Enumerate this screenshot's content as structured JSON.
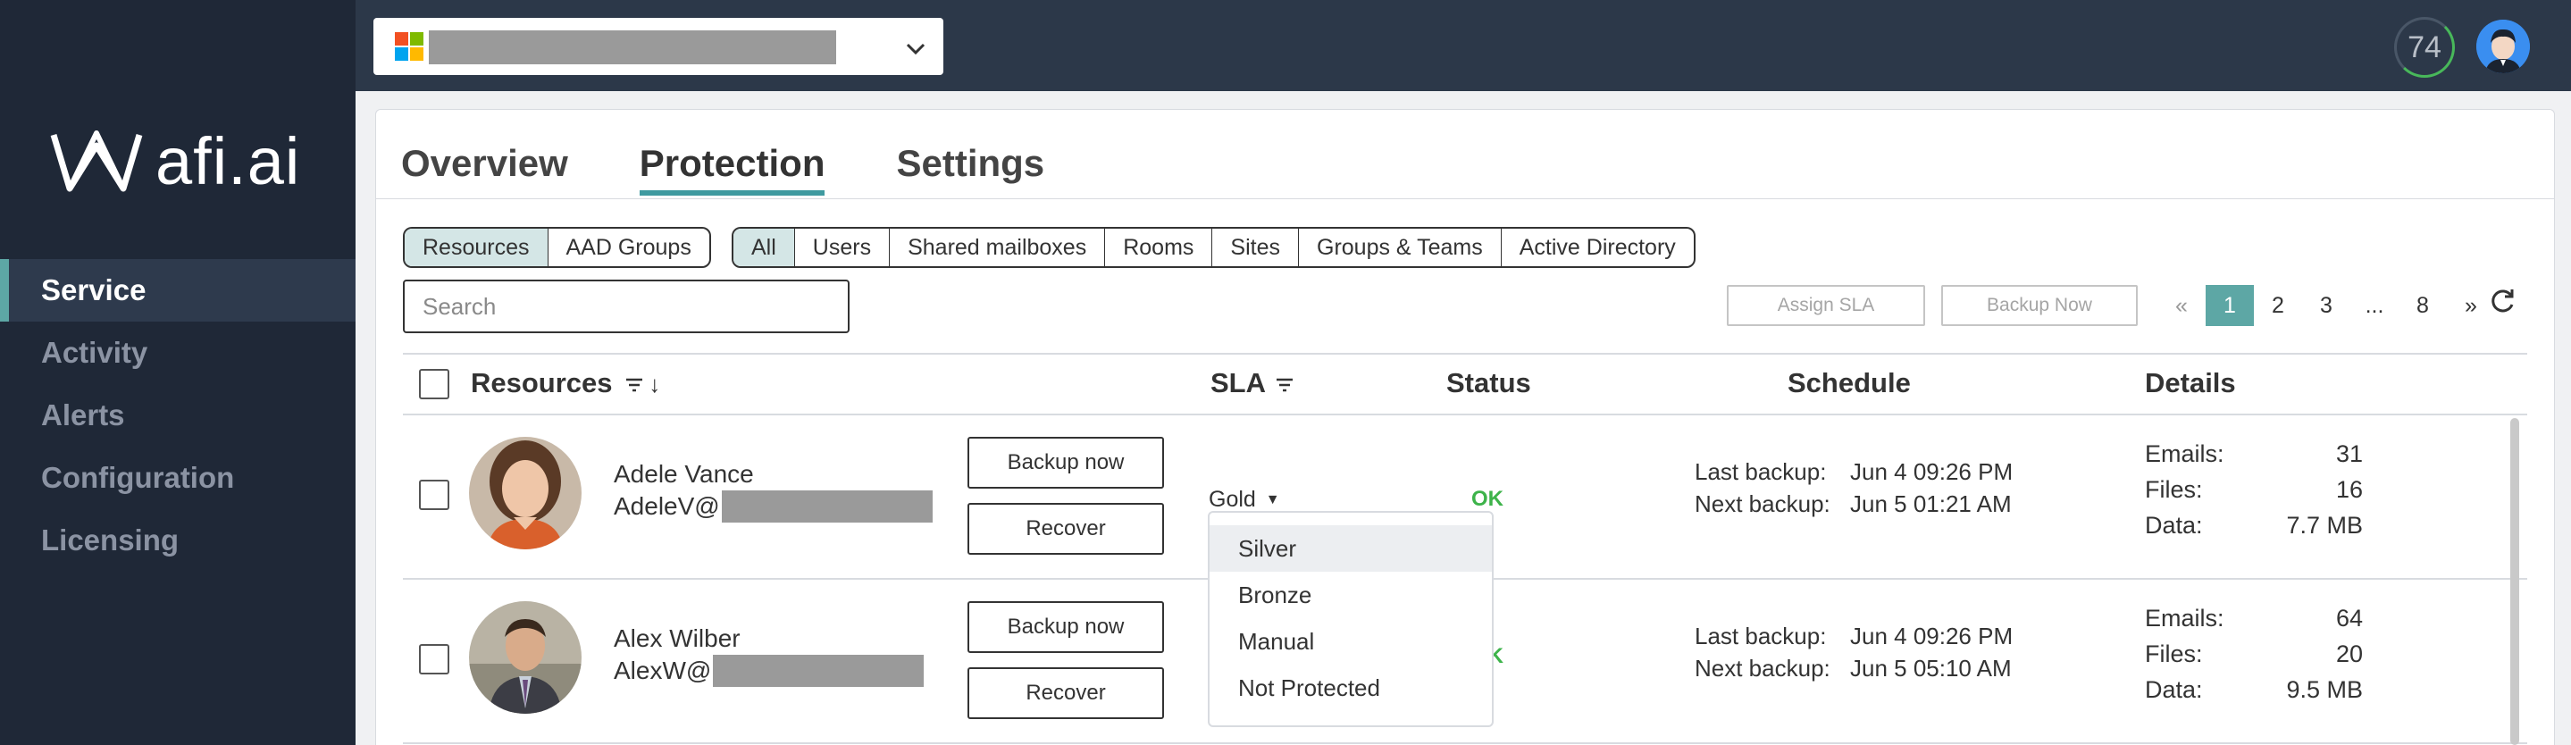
{
  "brand": {
    "logo_text": "afi.ai"
  },
  "sidebar": {
    "items": [
      {
        "label": "Service"
      },
      {
        "label": "Activity"
      },
      {
        "label": "Alerts"
      },
      {
        "label": "Configuration"
      },
      {
        "label": "Licensing"
      }
    ]
  },
  "topbar": {
    "score": "74"
  },
  "tabs": [
    {
      "label": "Overview"
    },
    {
      "label": "Protection"
    },
    {
      "label": "Settings"
    }
  ],
  "scope_filter": [
    {
      "label": "Resources"
    },
    {
      "label": "AAD Groups"
    }
  ],
  "type_filter": [
    {
      "label": "All"
    },
    {
      "label": "Users"
    },
    {
      "label": "Shared mailboxes"
    },
    {
      "label": "Rooms"
    },
    {
      "label": "Sites"
    },
    {
      "label": "Groups & Teams"
    },
    {
      "label": "Active Directory"
    }
  ],
  "search": {
    "placeholder": "Search"
  },
  "actions": {
    "assign_sla": "Assign SLA",
    "backup_now": "Backup Now"
  },
  "pager": {
    "prev": "«",
    "pages": [
      "1",
      "2",
      "3",
      "...",
      "8"
    ],
    "next": "»"
  },
  "table": {
    "headers": {
      "resources": "Resources",
      "sla": "SLA",
      "status": "Status",
      "schedule": "Schedule",
      "details": "Details"
    },
    "rows": [
      {
        "name": "Adele Vance",
        "email_prefix": "AdeleV@",
        "sla": "Gold",
        "status": "OK",
        "backup_btn": "Backup now",
        "recover_btn": "Recover",
        "last_backup_label": "Last backup:",
        "last_backup": "Jun 4 09:26 PM",
        "next_backup_label": "Next backup:",
        "next_backup": "Jun 5 01:21 AM",
        "emails_label": "Emails:",
        "emails": "31",
        "files_label": "Files:",
        "files": "16",
        "data_label": "Data:",
        "data": "7.7 MB"
      },
      {
        "name": "Alex Wilber",
        "email_prefix": "AlexW@",
        "sla": "",
        "status": "OK",
        "backup_btn": "Backup now",
        "recover_btn": "Recover",
        "last_backup_label": "Last backup:",
        "last_backup": "Jun 4 09:26 PM",
        "next_backup_label": "Next backup:",
        "next_backup": "Jun 5 05:10 AM",
        "emails_label": "Emails:",
        "emails": "64",
        "files_label": "Files:",
        "files": "20",
        "data_label": "Data:",
        "data": "9.5 MB"
      }
    ]
  },
  "sla_dropdown": {
    "options": [
      "Silver",
      "Bronze",
      "Manual",
      "Not Protected"
    ]
  },
  "colors": {
    "accent": "#5da7a5",
    "sidebar_bg": "#1f2837",
    "topbar_bg": "#2c3849",
    "ok_green": "#3db34a",
    "redaction_gray": "#9a9a9a"
  }
}
